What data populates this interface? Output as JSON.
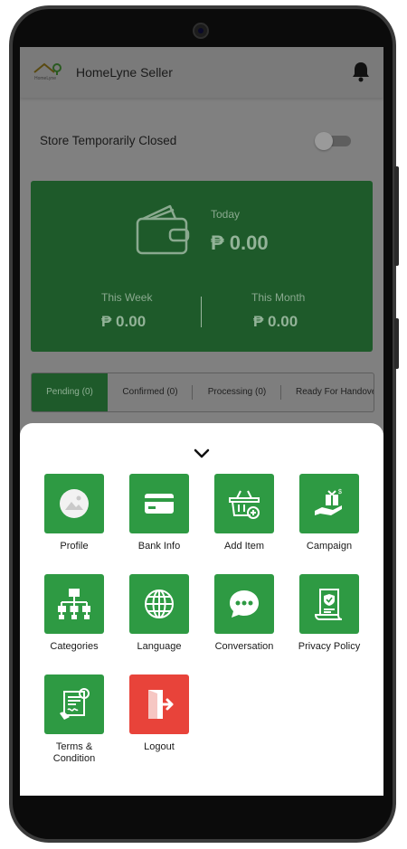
{
  "app": {
    "title": "HomeLyne Seller",
    "logo_text": "HomeLyne"
  },
  "store": {
    "label": "Store Temporarily Closed",
    "toggle_on": false
  },
  "earnings": {
    "today_label": "Today",
    "today_amount": "₱ 0.00",
    "week_label": "This Week",
    "week_amount": "₱ 0.00",
    "month_label": "This Month",
    "month_amount": "₱ 0.00"
  },
  "order_tabs": [
    {
      "label": "Pending (0)",
      "active": true
    },
    {
      "label": "Confirmed (0)",
      "active": false
    },
    {
      "label": "Processing (0)",
      "active": false
    },
    {
      "label": "Ready For Handover",
      "active": false
    }
  ],
  "menu": {
    "items": [
      {
        "label": "Profile",
        "icon": "profile-icon"
      },
      {
        "label": "Bank Info",
        "icon": "bank-card-icon"
      },
      {
        "label": "Add Item",
        "icon": "add-item-basket-icon"
      },
      {
        "label": "Campaign",
        "icon": "campaign-icon"
      },
      {
        "label": "Categories",
        "icon": "categories-icon"
      },
      {
        "label": "Language",
        "icon": "globe-icon"
      },
      {
        "label": "Conversation",
        "icon": "chat-icon"
      },
      {
        "label": "Privacy Policy",
        "icon": "privacy-policy-icon"
      },
      {
        "label": "Terms & Condition",
        "icon": "terms-icon"
      },
      {
        "label": "Logout",
        "icon": "logout-icon"
      }
    ]
  },
  "colors": {
    "primary_green": "#2e9a43",
    "logout_red": "#e8433a",
    "dimmed_green": "#1e5a2a"
  }
}
